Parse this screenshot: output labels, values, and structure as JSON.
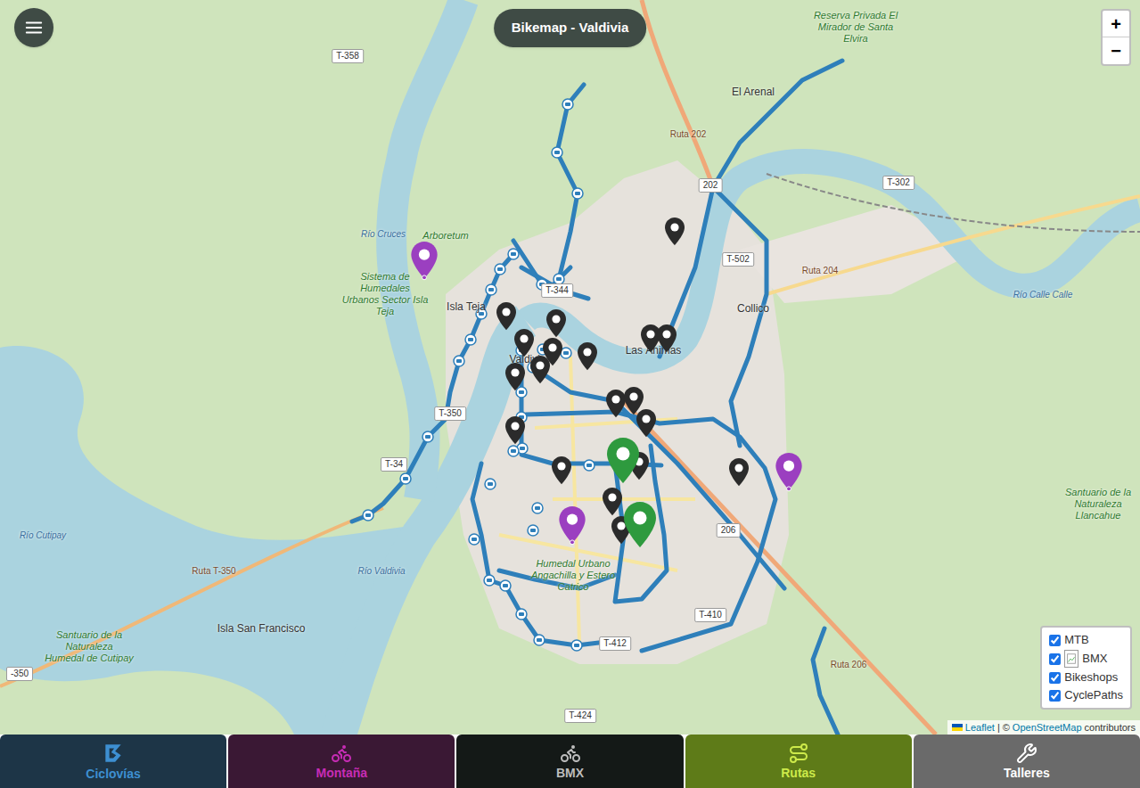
{
  "window": {
    "title": "Bikemap - Valdivia"
  },
  "zoom": {
    "in": "+",
    "out": "−"
  },
  "map_labels": [
    {
      "text": "T-358",
      "kind": "shield"
    },
    {
      "text": "Reserva Privada El Mirador de Santa Elvira",
      "kind": "park"
    },
    {
      "text": "El Arenal",
      "kind": "place"
    },
    {
      "text": "Ruta 202",
      "kind": "road"
    },
    {
      "text": "202",
      "kind": "shield"
    },
    {
      "text": "T-302",
      "kind": "shield"
    },
    {
      "text": "Ruta 204",
      "kind": "road"
    },
    {
      "text": "Río Calle Calle",
      "kind": "water"
    },
    {
      "text": "Arboretum",
      "kind": "park"
    },
    {
      "text": "Sistema de Humedales Urbanos Sector Isla Teja",
      "kind": "park"
    },
    {
      "text": "Isla Teja",
      "kind": "place"
    },
    {
      "text": "T-344",
      "kind": "shield"
    },
    {
      "text": "T-502",
      "kind": "shield"
    },
    {
      "text": "Collico",
      "kind": "place"
    },
    {
      "text": "Las Ánimas",
      "kind": "place"
    },
    {
      "text": "Valdivia",
      "kind": "place"
    },
    {
      "text": "T-350",
      "kind": "shield"
    },
    {
      "text": "T-34",
      "kind": "shield"
    },
    {
      "text": "Río Cruces",
      "kind": "water"
    },
    {
      "text": "Río Valdivia",
      "kind": "water"
    },
    {
      "text": "Río Cutipay",
      "kind": "water"
    },
    {
      "text": "Santuario de la Naturaleza Llancahue",
      "kind": "park"
    },
    {
      "text": "206",
      "kind": "shield"
    },
    {
      "text": "Humedal Urbano Angachilla y Estero Catrico",
      "kind": "park"
    },
    {
      "text": "T-410",
      "kind": "shield"
    },
    {
      "text": "T-412",
      "kind": "shield"
    },
    {
      "text": "T-424",
      "kind": "shield"
    },
    {
      "text": "Isla San Francisco",
      "kind": "place"
    },
    {
      "text": "Santuario de la Naturaleza Humedal de Cutipay",
      "kind": "park"
    },
    {
      "text": "Ruta T-350",
      "kind": "road"
    },
    {
      "text": "Ruta 206",
      "kind": "road"
    },
    {
      "text": "-350",
      "kind": "shield"
    }
  ],
  "markers": [
    {
      "kind": "bikeshop",
      "color": "#2b2b2b"
    },
    {
      "kind": "bikeshop",
      "color": "#2b2b2b"
    },
    {
      "kind": "bikeshop",
      "color": "#2b2b2b"
    },
    {
      "kind": "bikeshop",
      "color": "#2b2b2b"
    },
    {
      "kind": "bikeshop",
      "color": "#2b2b2b"
    },
    {
      "kind": "bikeshop",
      "color": "#2b2b2b"
    },
    {
      "kind": "bikeshop",
      "color": "#2b2b2b"
    },
    {
      "kind": "bikeshop",
      "color": "#2b2b2b"
    },
    {
      "kind": "bikeshop",
      "color": "#2b2b2b"
    },
    {
      "kind": "bikeshop",
      "color": "#2b2b2b"
    },
    {
      "kind": "bikeshop",
      "color": "#2b2b2b"
    },
    {
      "kind": "bikeshop",
      "color": "#2b2b2b"
    },
    {
      "kind": "bikeshop",
      "color": "#2b2b2b"
    },
    {
      "kind": "bikeshop",
      "color": "#2b2b2b"
    },
    {
      "kind": "bikeshop",
      "color": "#2b2b2b"
    },
    {
      "kind": "bikeshop",
      "color": "#2b2b2b"
    },
    {
      "kind": "bikeshop",
      "color": "#2b2b2b"
    },
    {
      "kind": "bikeshop",
      "color": "#2b2b2b"
    },
    {
      "kind": "bikeshop",
      "color": "#2b2b2b"
    },
    {
      "kind": "bmx",
      "color": "#2e9a3e"
    },
    {
      "kind": "bmx",
      "color": "#2e9a3e"
    },
    {
      "kind": "mtb",
      "color": "#9b3fc0"
    },
    {
      "kind": "mtb",
      "color": "#9b3fc0"
    },
    {
      "kind": "mtb",
      "color": "#9b3fc0"
    }
  ],
  "layers": [
    {
      "label": "MTB",
      "checked": true,
      "kind": "plain"
    },
    {
      "label": "BMX",
      "checked": true,
      "kind": "image"
    },
    {
      "label": "Bikeshops",
      "checked": true,
      "kind": "plain"
    },
    {
      "label": "CyclePaths",
      "checked": true,
      "kind": "plain"
    }
  ],
  "attribution": {
    "leaflet": "Leaflet",
    "separator": "|",
    "copyright": "©",
    "osm": "OpenStreetMap",
    "suffix": "contributors"
  },
  "nav": [
    {
      "label": "Ciclovías",
      "kind": "cyclepath",
      "color": "#3d8fd1",
      "background": "#1d3547"
    },
    {
      "label": "Montaña",
      "kind": "mtb",
      "color": "#c72cb5",
      "background": "#3a1834"
    },
    {
      "label": "BMX",
      "kind": "bmx",
      "color": "#bdbdbd",
      "background": "#141917"
    },
    {
      "label": "Rutas",
      "kind": "routes",
      "color": "#cdea4a",
      "background": "#5e7b18"
    },
    {
      "label": "Talleres",
      "kind": "workshop",
      "color": "#ffffff",
      "background": "#6a6a6a"
    }
  ]
}
